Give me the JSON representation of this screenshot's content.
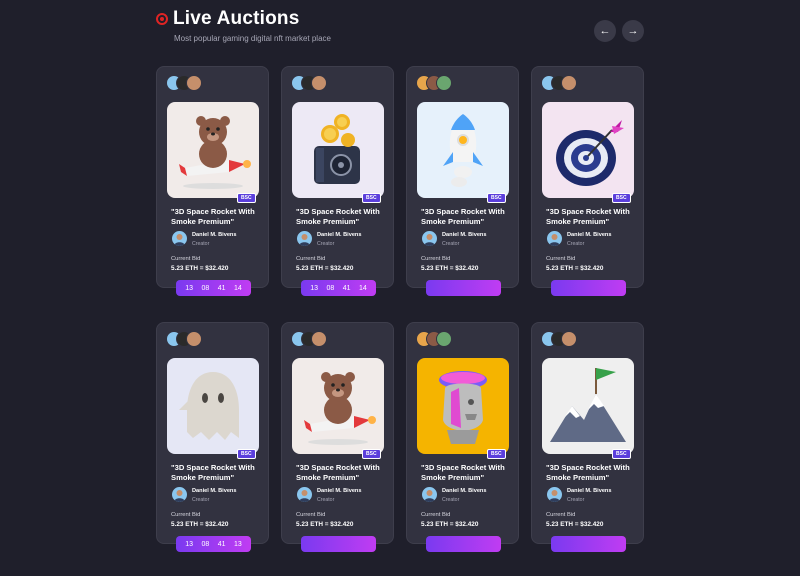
{
  "header": {
    "title": "Live Auctions",
    "subtitle": "Most popular gaming digital nft market place",
    "prev_icon": "arrow-left-icon",
    "next_icon": "arrow-right-icon",
    "accent": "#e02424"
  },
  "cards": [
    {
      "art": "teddy-bear-rocket",
      "chain": "BSC",
      "title": "\"3D Space Rocket With Smoke Premium\"",
      "creator": "Daniel M. Bivens",
      "role": "Creator",
      "bid_label": "Current Bid",
      "bid": "5.23 ETH = $32.420",
      "timer": [
        "13",
        "08",
        "41",
        "14"
      ]
    },
    {
      "art": "coin-safe",
      "chain": "BSC",
      "title": "\"3D Space Rocket With Smoke Premium\"",
      "creator": "Daniel M. Bivens",
      "role": "Creator",
      "bid_label": "Current Bid",
      "bid": "5.23 ETH = $32.420",
      "timer": [
        "13",
        "08",
        "41",
        "14"
      ]
    },
    {
      "art": "rocket",
      "chain": "BSC",
      "title": "\"3D Space Rocket With Smoke Premium\"",
      "creator": "Daniel M. Bivens",
      "role": "Creator",
      "bid_label": "Current Bid",
      "bid": "5.23 ETH = $32.420",
      "timer": []
    },
    {
      "art": "dart-target",
      "chain": "BSC",
      "title": "\"3D Space Rocket With Smoke Premium\"",
      "creator": "Daniel M. Bivens",
      "role": "Creator",
      "bid_label": "Current Bid",
      "bid": "5.23 ETH = $32.420",
      "timer": []
    },
    {
      "art": "ghost",
      "chain": "BSC",
      "title": "\"3D Space Rocket With Smoke Premium\"",
      "creator": "Daniel M. Bivens",
      "role": "Creator",
      "bid_label": "Current Bid",
      "bid": "5.23 ETH = $32.420",
      "timer": [
        "13",
        "08",
        "41",
        "13"
      ]
    },
    {
      "art": "teddy-bear-rocket",
      "chain": "BSC",
      "title": "\"3D Space Rocket With Smoke Premium\"",
      "creator": "Daniel M. Bivens",
      "role": "Creator",
      "bid_label": "Current Bid",
      "bid": "5.23 ETH = $32.420",
      "timer": []
    },
    {
      "art": "statue-head",
      "chain": "BSC",
      "title": "\"3D Space Rocket With Smoke Premium\"",
      "creator": "Daniel M. Bivens",
      "role": "Creator",
      "bid_label": "Current Bid",
      "bid": "5.23 ETH = $32.420",
      "timer": []
    },
    {
      "art": "mountain-flag",
      "chain": "BSC",
      "title": "\"3D Space Rocket With Smoke Premium\"",
      "creator": "Daniel M. Bivens",
      "role": "Creator",
      "bid_label": "Current Bid",
      "bid": "5.23 ETH = $32.420",
      "timer": []
    }
  ]
}
